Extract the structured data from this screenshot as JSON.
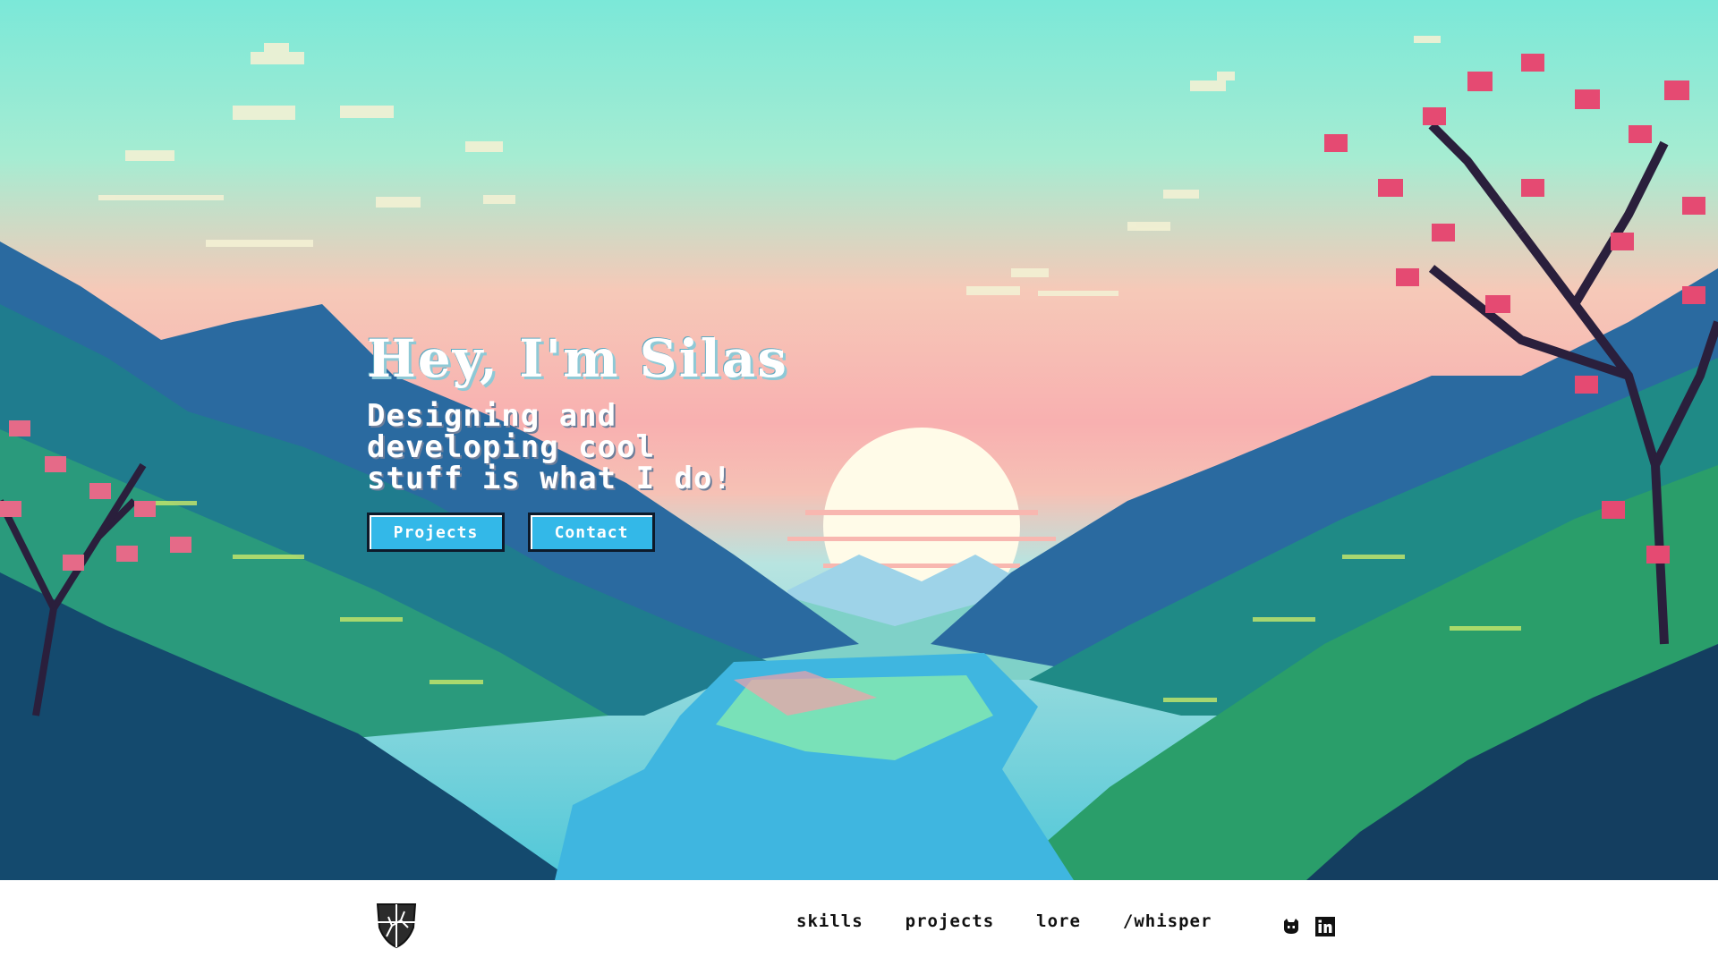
{
  "hero": {
    "title": "Hey, I'm Silas",
    "subtitle_lines": [
      "Designing and",
      "developing cool",
      "stuff is what I do!"
    ],
    "buttons": {
      "projects": "Projects",
      "contact": "Contact"
    }
  },
  "nav": {
    "links": [
      "skills",
      "projects",
      "lore",
      "/whisper"
    ],
    "social": [
      "github-icon",
      "linkedin-icon"
    ]
  },
  "colors": {
    "button_bg": "#33b8e8",
    "nav_bg": "#ffffff",
    "sky_top": "#7be8d8",
    "sky_horizon": "#f8b0b0"
  }
}
